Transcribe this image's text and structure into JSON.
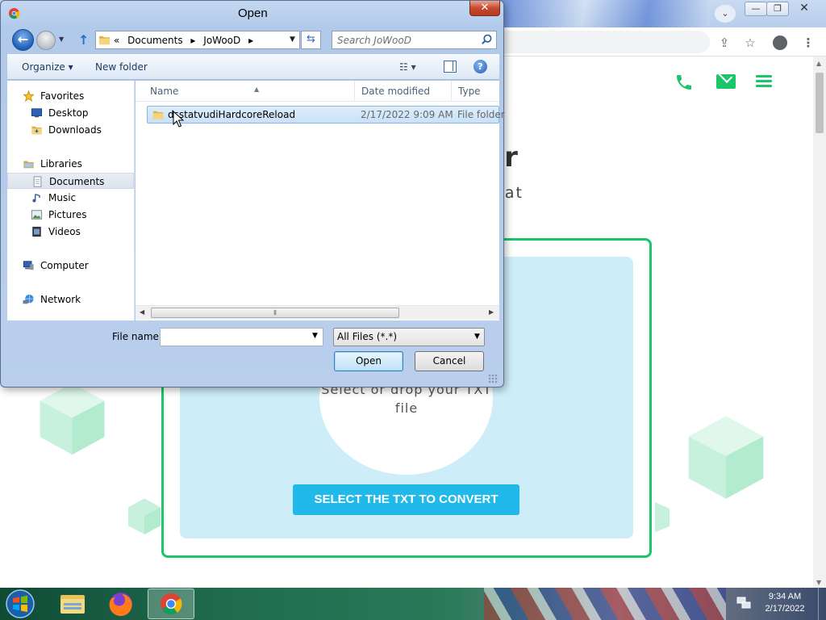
{
  "browser": {
    "toolbar_icons": [
      "share-icon",
      "bookmark-star-icon",
      "profile-icon",
      "chrome-menu-icon"
    ]
  },
  "webpage": {
    "header_icons": [
      "phone-icon",
      "mail-icon",
      "menu-icon"
    ],
    "title_fragment": "rter",
    "subtitle_fragment": "Format",
    "drop_text": "Select or drop your TXT file",
    "select_button": "SELECT THE TXT TO CONVERT",
    "accent_color": "#1dc56a",
    "button_color": "#21b9ea",
    "dropzone_color": "#cdeef8"
  },
  "dialog": {
    "title": "Open",
    "close_label": "✕",
    "nav": {
      "breadcrumb_prefix": "«",
      "breadcrumbs": [
        "Documents",
        "JoWooD"
      ],
      "search_placeholder": "Search JoWooD"
    },
    "command_bar": {
      "organize": "Organize ▾",
      "new_folder": "New folder",
      "views": "☷ ▾"
    },
    "nav_pane": {
      "items": [
        {
          "label": "Favorites",
          "icon": "star-icon"
        },
        {
          "label": "Desktop",
          "icon": "desktop-icon"
        },
        {
          "label": "Downloads",
          "icon": "downloads-folder-icon"
        },
        {
          "label": "Libraries",
          "icon": "libraries-icon"
        },
        {
          "label": "Documents",
          "icon": "documents-icon",
          "selected": true
        },
        {
          "label": "Music",
          "icon": "music-icon"
        },
        {
          "label": "Pictures",
          "icon": "pictures-icon"
        },
        {
          "label": "Videos",
          "icon": "videos-icon"
        },
        {
          "label": "Computer",
          "icon": "computer-icon"
        },
        {
          "label": "Network",
          "icon": "network-icon"
        }
      ]
    },
    "columns": [
      "Name",
      "Date modified",
      "Type"
    ],
    "files": [
      {
        "name": "dsstatvudiHardcoreReload",
        "date_modified": "2/17/2022 9:09 AM",
        "type": "File folder"
      }
    ],
    "filename_label": "File name:",
    "filename_value": "",
    "filetype": "All Files (*.*)",
    "open_button": "Open",
    "cancel_button": "Cancel"
  },
  "taskbar": {
    "apps": [
      "windows-explorer",
      "firefox",
      "google-chrome"
    ],
    "clock_time": "9:34 AM",
    "clock_date": "2/17/2022"
  }
}
